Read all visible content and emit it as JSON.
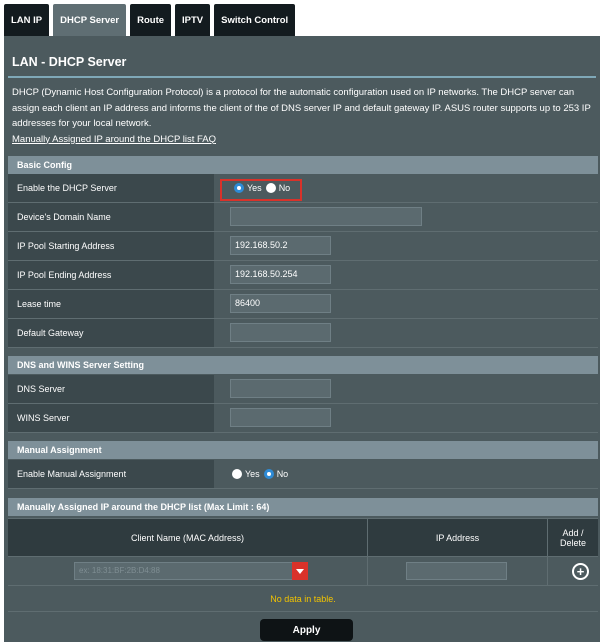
{
  "tabs": [
    "LAN IP",
    "DHCP Server",
    "Route",
    "IPTV",
    "Switch Control"
  ],
  "active_tab": "DHCP Server",
  "page_title": "LAN - DHCP Server",
  "description": {
    "text": "DHCP (Dynamic Host Configuration Protocol) is a protocol for the automatic configuration used on IP networks. The DHCP server can assign each client an IP address and informs the client of the of DNS server IP and default gateway IP. ASUS router supports up to 253 IP addresses for your local network.",
    "link": "Manually Assigned IP around the DHCP list FAQ"
  },
  "basic_config": {
    "header": "Basic Config",
    "enable_dhcp": {
      "label": "Enable the DHCP Server",
      "yes": "Yes",
      "no": "No",
      "selected": "Yes"
    },
    "domain_name": {
      "label": "Device's Domain Name",
      "value": ""
    },
    "pool_start": {
      "label": "IP Pool Starting Address",
      "value": "192.168.50.2"
    },
    "pool_end": {
      "label": "IP Pool Ending Address",
      "value": "192.168.50.254"
    },
    "lease_time": {
      "label": "Lease time",
      "value": "86400"
    },
    "gateway": {
      "label": "Default Gateway",
      "value": ""
    }
  },
  "dns_wins": {
    "header": "DNS and WINS Server Setting",
    "dns": {
      "label": "DNS Server",
      "value": ""
    },
    "wins": {
      "label": "WINS Server",
      "value": ""
    }
  },
  "manual": {
    "header": "Manual Assignment",
    "enable": {
      "label": "Enable Manual Assignment",
      "yes": "Yes",
      "no": "No",
      "selected": "No"
    }
  },
  "manual_list": {
    "header": "Manually Assigned IP around the DHCP list (Max Limit : 64)",
    "col_client": "Client Name (MAC Address)",
    "col_ip": "IP Address",
    "col_action": "Add / Delete",
    "select_placeholder": "ex: 18:31:BF:2B:D4:88",
    "ip_value": "",
    "no_data": "No data in table."
  },
  "apply_label": "Apply",
  "colors": {
    "accent_highlight": "#d9322a",
    "radio_on": "#2e8bd6",
    "no_data_text": "#f2c300"
  }
}
